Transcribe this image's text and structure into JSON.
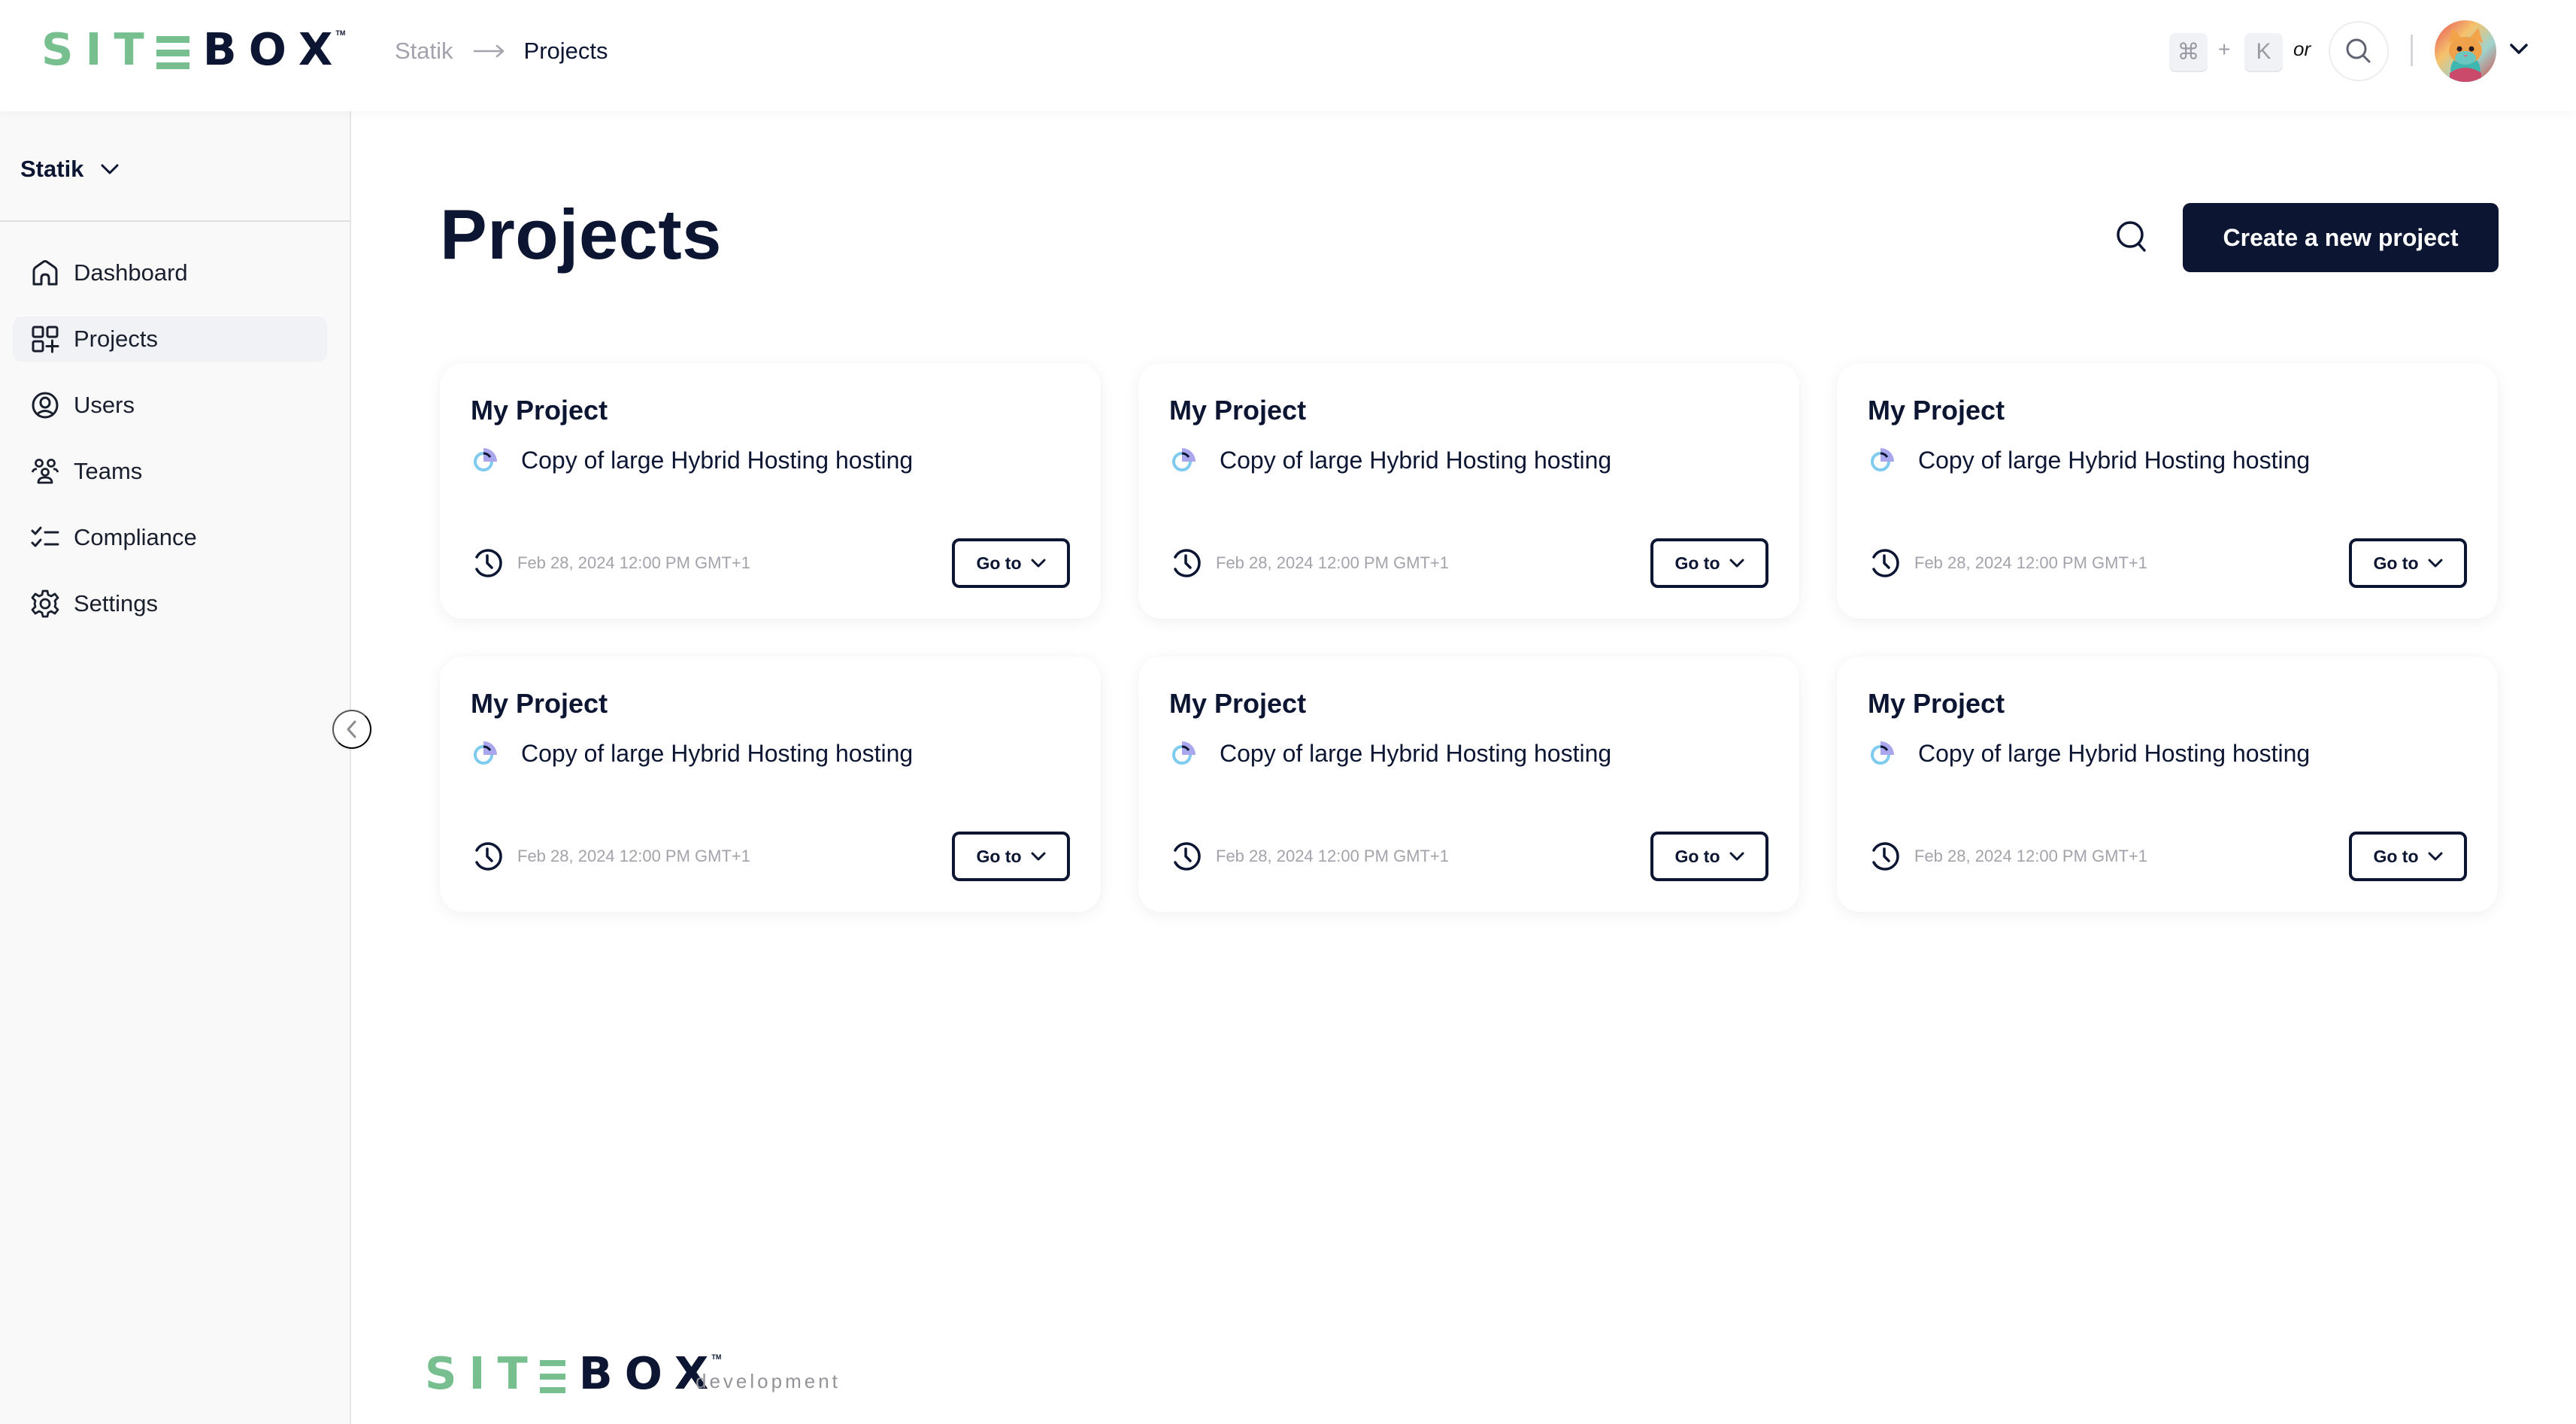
{
  "brand": {
    "name_green": "SIT",
    "name_dark": "BOX",
    "trademark": "TM",
    "colors": {
      "green": "#77bf8f",
      "navy": "#0c1633"
    }
  },
  "header": {
    "breadcrumb": [
      {
        "label": "Statik"
      },
      {
        "label": "Projects"
      }
    ],
    "shortcut": {
      "key1": "⌘",
      "plus": "+",
      "key2": "K",
      "or": "or"
    },
    "search_icon": "search-icon",
    "avatar_alt": "User avatar (cat illustration)"
  },
  "sidebar": {
    "org": "Statik",
    "items": [
      {
        "label": "Dashboard",
        "icon": "home-icon",
        "active": false
      },
      {
        "label": "Projects",
        "icon": "projects-grid-icon",
        "active": true
      },
      {
        "label": "Users",
        "icon": "user-circle-icon",
        "active": false
      },
      {
        "label": "Teams",
        "icon": "teams-icon",
        "active": false
      },
      {
        "label": "Compliance",
        "icon": "checklist-icon",
        "active": false
      },
      {
        "label": "Settings",
        "icon": "gear-icon",
        "active": false
      }
    ]
  },
  "main": {
    "title": "Projects",
    "create_button": "Create a new project",
    "projects": [
      {
        "title": "My Project",
        "status": "Copy of large Hybrid Hosting hosting",
        "date": "Feb 28, 2024 12:00 PM GMT+1",
        "action": "Go to"
      },
      {
        "title": "My Project",
        "status": "Copy of large Hybrid Hosting hosting",
        "date": "Feb 28, 2024 12:00 PM GMT+1",
        "action": "Go to"
      },
      {
        "title": "My Project",
        "status": "Copy of large Hybrid Hosting hosting",
        "date": "Feb 28, 2024 12:00 PM GMT+1",
        "action": "Go to"
      },
      {
        "title": "My Project",
        "status": "Copy of large Hybrid Hosting hosting",
        "date": "Feb 28, 2024 12:00 PM GMT+1",
        "action": "Go to"
      },
      {
        "title": "My Project",
        "status": "Copy of large Hybrid Hosting hosting",
        "date": "Feb 28, 2024 12:00 PM GMT+1",
        "action": "Go to"
      },
      {
        "title": "My Project",
        "status": "Copy of large Hybrid Hosting hosting",
        "date": "Feb 28, 2024 12:00 PM GMT+1",
        "action": "Go to"
      }
    ]
  },
  "footer": {
    "environment": "development"
  }
}
